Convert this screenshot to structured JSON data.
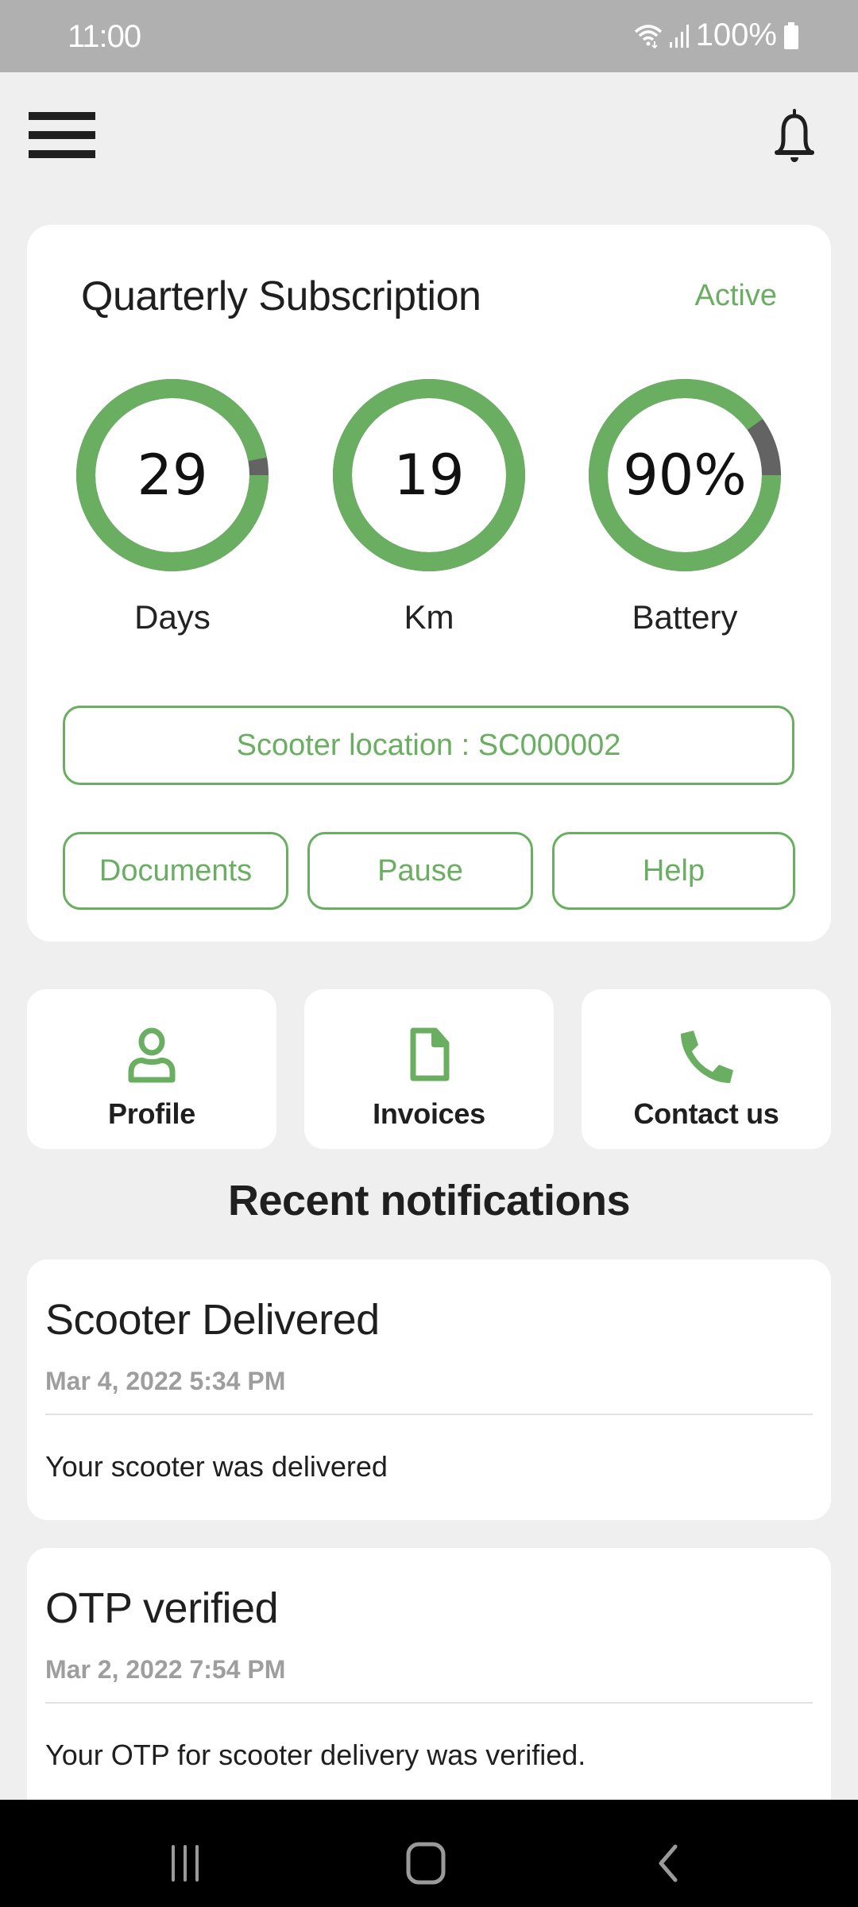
{
  "status_bar": {
    "time": "11:00",
    "battery_text": "100%",
    "icons": [
      "wifi-icon",
      "signal-icon",
      "battery-icon"
    ]
  },
  "header": {
    "menu_icon": "hamburger-menu-icon",
    "notification_icon": "bell-icon"
  },
  "subscription": {
    "title": "Quarterly Subscription",
    "status": "Active",
    "gauges": [
      {
        "value_text": "29",
        "label": "Days",
        "fill_fraction": 0.97
      },
      {
        "value_text": "19",
        "label": "Km",
        "fill_fraction": 1.0
      },
      {
        "value_text": "90%",
        "label": "Battery",
        "fill_fraction": 0.9
      }
    ],
    "location_button": "Scooter location : SC000002",
    "actions": [
      "Documents",
      "Pause",
      "Help"
    ]
  },
  "quick_links": [
    {
      "label": "Profile",
      "icon": "profile-icon"
    },
    {
      "label": "Invoices",
      "icon": "document-icon"
    },
    {
      "label": "Contact us",
      "icon": "phone-icon"
    }
  ],
  "notifications": {
    "title": "Recent notifications",
    "items": [
      {
        "title": "Scooter Delivered",
        "date": "Mar 4, 2022 5:34 PM",
        "body": "Your scooter was delivered"
      },
      {
        "title": "OTP verified",
        "date": "Mar 2, 2022 7:54 PM",
        "body": "Your OTP for scooter delivery was verified."
      }
    ]
  },
  "colors": {
    "accent": "#6aae62",
    "gauge_remainder": "#636363",
    "background": "#efefef",
    "status_bar": "#b0b0b0"
  },
  "nav_bar": {
    "buttons": [
      "recent-apps-icon",
      "home-icon",
      "back-icon"
    ]
  }
}
